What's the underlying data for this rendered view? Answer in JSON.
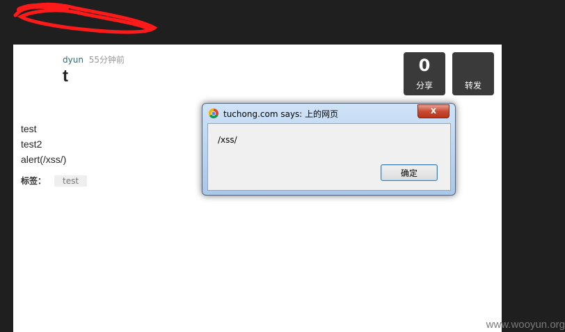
{
  "post": {
    "author": "dyun",
    "time": "55分钟前",
    "title": "t",
    "content_lines": [
      "test",
      "test2",
      "alert(/xss/)"
    ],
    "tags_label": "标签：",
    "tags": [
      "test"
    ]
  },
  "actions": {
    "share_count": "0",
    "share_label": "分享",
    "repost_label": "转发"
  },
  "dialog": {
    "title": "tuchong.com says: 上的网页",
    "message": "/xss/",
    "ok_label": "确定",
    "close_label": "x"
  },
  "watermark": "www.wooyun.org",
  "colors": {
    "background": "#1f1f20",
    "scribble": "#ff1a1a",
    "author_link": "#2d6a73",
    "stat_button": "#3a3a3a"
  }
}
